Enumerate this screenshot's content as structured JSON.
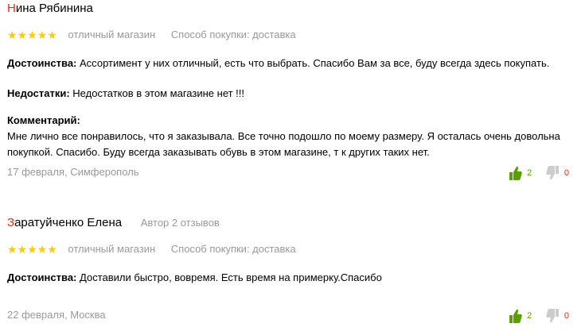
{
  "reviews": [
    {
      "author_initial": "Н",
      "author_rest": "ина Рябинина",
      "author_meta": "",
      "rating": 5,
      "stars": "★★★★★",
      "verdict": "отличный магазин",
      "purchase": "Способ покупки: доставка",
      "pros_label": "Достоинства:",
      "pros": "Ассортимент у них отличный, есть что выбрать. Спасибо Вам за все, буду всегда здесь покупать.",
      "cons_label": "Недостатки:",
      "cons": "Недостатков в этом магазине нет !!!",
      "comment_label": "Комментарий:",
      "comment": "Мне лично все понравилось, что я заказывала. Все точно подошло по моему размеру. Я осталась очень довольна покупкой. Спасибо. Буду всегда заказывать обувь в этом магазине, т к других таких нет.",
      "date_city": "17 февраля, Симферополь",
      "votes_up": "2",
      "votes_down": "0"
    },
    {
      "author_initial": "З",
      "author_rest": "аратуйченко Елена",
      "author_meta": "Автор 2 отзывов",
      "rating": 5,
      "stars": "★★★★★",
      "verdict": "отличный магазин",
      "purchase": "Способ покупки: доставка",
      "pros_label": "Достоинства:",
      "pros": "Доставили быстро, вовремя. Есть время на примерку.Спасибо",
      "date_city": "22 февраля, Москва",
      "votes_up": "2",
      "votes_down": "0"
    }
  ],
  "colors": {
    "star": "#ffcc00",
    "author_initial": "#e52b0f",
    "vote_up": "#5a9e00",
    "vote_down_icon": "#cccccc",
    "meta_text": "#999999"
  },
  "icons": [
    "thumb-up-icon",
    "thumb-down-icon"
  ]
}
